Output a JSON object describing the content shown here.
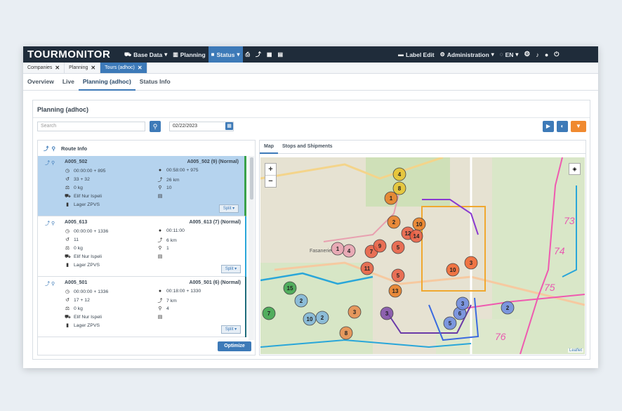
{
  "brand": "TOURMONITOR",
  "nav": {
    "base_data": "Base Data",
    "planning": "Planning",
    "status": "Status",
    "label_edit": "Label Edit",
    "administration": "Administration",
    "language": "EN"
  },
  "page_tabs": [
    {
      "label": "Companies"
    },
    {
      "label": "Planning"
    },
    {
      "label": "Tours (adhoc)"
    }
  ],
  "subnav": [
    "Overview",
    "Live",
    "Planning (adhoc)",
    "Status Info"
  ],
  "panel": {
    "title": "Planning (adhoc)",
    "search_placeholder": "Search",
    "date": "02/22/2023"
  },
  "route_info": {
    "header": "Route Info",
    "routes": [
      {
        "name": "A005_502",
        "title": "A005_502 (9) (Normal)",
        "time_start": "00:00:00 + 895",
        "time_end": "00:58:00 + 975",
        "stops": "33 + 32",
        "distance": "26 km",
        "weight": "0 kg",
        "count": "10",
        "driver": "Elif Nur Ispeli",
        "depot": "Lager ZPVS",
        "split": "Split",
        "color": "#3aa24a"
      },
      {
        "name": "A005_613",
        "title": "A005_613 (7) (Normal)",
        "time_start": "00:00:00 + 1336",
        "time_end": "00:11:00",
        "stops": "11",
        "distance": "6 km",
        "weight": "0 kg",
        "count": "1",
        "driver": "Elif Nur Ispeli",
        "depot": "Lager ZPVS",
        "split": "Split",
        "color": "#29a6d9"
      },
      {
        "name": "A005_501",
        "title": "A005_501 (6) (Normal)",
        "time_start": "00:00:00 + 1336",
        "time_end": "00:18:00 + 1330",
        "stops": "17 + 12",
        "distance": "7 km",
        "weight": "0 kg",
        "count": "4",
        "driver": "Elif Nur Ispeli",
        "depot": "Lager ZPVS",
        "split": "Split",
        "color": "#1d6b7a"
      }
    ],
    "optimize": "Optimize"
  },
  "map": {
    "tabs": [
      "Map",
      "Stops and Shipments"
    ],
    "place_label": "Fasanerie",
    "road_labels": [
      "73",
      "74",
      "75",
      "76"
    ],
    "attribution": "Leaflet",
    "zoom_in": "+",
    "zoom_out": "−",
    "markers": [
      {
        "n": "4",
        "c": "#e8c22a"
      },
      {
        "n": "8",
        "c": "#e8c22a"
      },
      {
        "n": "1",
        "c": "#e87a1f"
      },
      {
        "n": "2",
        "c": "#e87a1f"
      },
      {
        "n": "10",
        "c": "#e87a1f"
      },
      {
        "n": "12",
        "c": "#e85a3f"
      },
      {
        "n": "14",
        "c": "#e85a3f"
      },
      {
        "n": "5",
        "c": "#e85a3f"
      },
      {
        "n": "7",
        "c": "#e85a3f"
      },
      {
        "n": "9",
        "c": "#e85a3f"
      },
      {
        "n": "11",
        "c": "#e85a3f"
      },
      {
        "n": "5",
        "c": "#e85a3f"
      },
      {
        "n": "13",
        "c": "#e87a1f"
      },
      {
        "n": "10",
        "c": "#f0602a"
      },
      {
        "n": "3",
        "c": "#f0602a"
      },
      {
        "n": "4",
        "c": "#e8a0b0"
      },
      {
        "n": "1",
        "c": "#e8a0b0"
      },
      {
        "n": "7",
        "c": "#3aa24a"
      },
      {
        "n": "15",
        "c": "#3aa24a"
      },
      {
        "n": "2",
        "c": "#7fb4d9"
      },
      {
        "n": "10",
        "c": "#7fb4d9"
      },
      {
        "n": "2",
        "c": "#7fb4d9"
      },
      {
        "n": "8",
        "c": "#e88a4a"
      },
      {
        "n": "3",
        "c": "#e88a4a"
      },
      {
        "n": "3",
        "c": "#7c4aa8"
      },
      {
        "n": "5",
        "c": "#6a88e0"
      },
      {
        "n": "6",
        "c": "#6a88e0"
      },
      {
        "n": "3",
        "c": "#6a88e0"
      },
      {
        "n": "2",
        "c": "#6a88e0"
      }
    ]
  }
}
